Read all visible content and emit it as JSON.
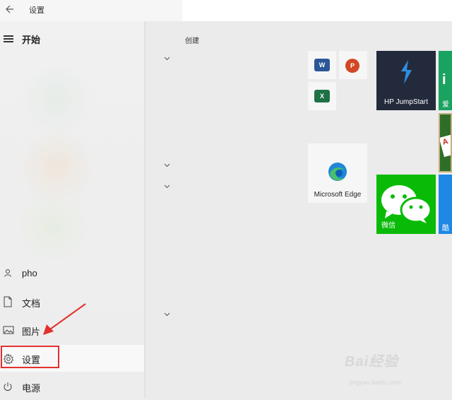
{
  "window": {
    "title": "设置",
    "back_icon": "back-arrow-icon"
  },
  "start": {
    "label": "开始",
    "menu_icon": "hamburger-icon"
  },
  "sidebar": {
    "items": [
      {
        "label": "pho",
        "icon": "user-icon"
      },
      {
        "label": "文档",
        "icon": "document-icon"
      },
      {
        "label": "图片",
        "icon": "picture-icon"
      },
      {
        "label": "设置",
        "icon": "gear-icon",
        "selected": true
      },
      {
        "label": "电源",
        "icon": "power-icon"
      }
    ]
  },
  "tiles": {
    "group_title": "创建",
    "word_badge": "W",
    "powerpoint_badge": "P",
    "excel_badge": "X",
    "hp_label": "HP JumpStart",
    "edge_label": "Microsoft Edge",
    "wechat_label": "微信",
    "partial_top_label": "爱",
    "partial_bottom_label": "酷",
    "card_letter": "A"
  },
  "colors": {
    "highlight": "#e2312e",
    "word": "#2b5797",
    "powerpoint": "#d24726",
    "excel": "#1e7145",
    "hp": "#232a3c",
    "wechat": "#09bb07",
    "partial_green": "#1aa261",
    "partial_blue": "#1e88e5"
  },
  "watermark": {
    "text": "Bai经验",
    "url": "jingyan.baidu.com"
  }
}
